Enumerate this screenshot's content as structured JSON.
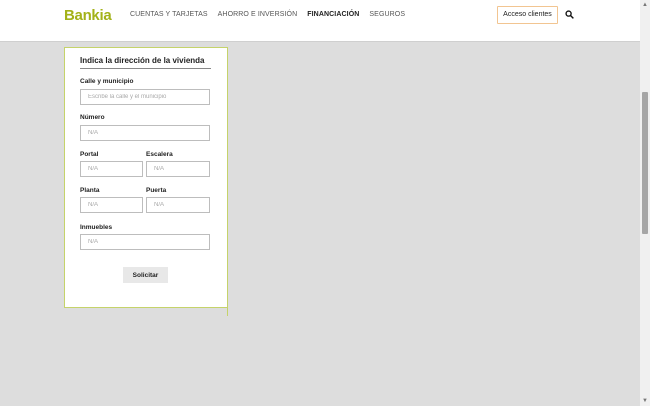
{
  "header": {
    "logo_text": "Bankia",
    "nav": [
      {
        "label": "CUENTAS Y TARJETAS",
        "active": false
      },
      {
        "label": "AHORRO E INVERSIÓN",
        "active": false
      },
      {
        "label": "FINANCIACIÓN",
        "active": true
      },
      {
        "label": "SEGUROS",
        "active": false
      }
    ],
    "access_button_label": "Acceso clientes",
    "search_icon": "search-icon"
  },
  "form": {
    "title": "Indica la dirección de la vivienda",
    "street": {
      "label": "Calle y municipio",
      "placeholder": "Escribe la calle y el municipio",
      "value": ""
    },
    "number": {
      "label": "Número",
      "placeholder": "N/A",
      "value": ""
    },
    "portal": {
      "label": "Portal",
      "placeholder": "N/A",
      "value": ""
    },
    "stair": {
      "label": "Escalera",
      "placeholder": "N/A",
      "value": ""
    },
    "floor": {
      "label": "Planta",
      "placeholder": "N/A",
      "value": ""
    },
    "door": {
      "label": "Puerta",
      "placeholder": "N/A",
      "value": ""
    },
    "properties": {
      "label": "Inmuebles",
      "placeholder": "N/A",
      "value": ""
    },
    "submit_label": "Solicitar"
  },
  "colors": {
    "brand": "#a3b219",
    "card_border": "#c5d36a",
    "access_border": "#f2c591",
    "background": "#dddddd"
  },
  "scrollbar": {
    "up_arrow": "▲",
    "down_arrow": "▼"
  }
}
